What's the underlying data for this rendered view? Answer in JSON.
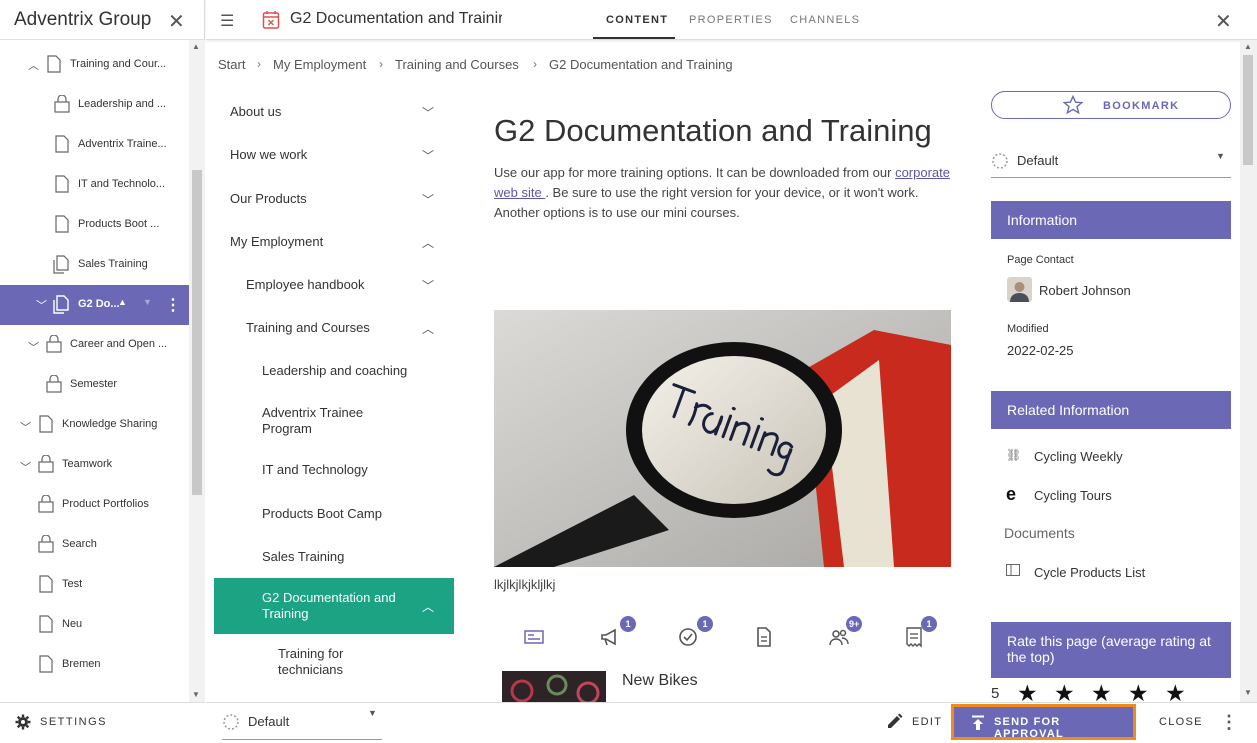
{
  "left_panel": {
    "title": "Adventrix Group",
    "settings_label": "SETTINGS",
    "items": [
      {
        "label": "Training and Cour...",
        "icon": "page-icon",
        "chevron": "up"
      },
      {
        "label": "Leadership and ...",
        "icon": "lock-icon"
      },
      {
        "label": "Adventrix Traine...",
        "icon": "page-icon"
      },
      {
        "label": "IT and Technolo...",
        "icon": "page-icon"
      },
      {
        "label": "Products Boot ...",
        "icon": "page-icon"
      },
      {
        "label": "Sales Training",
        "icon": "copy-page-icon"
      },
      {
        "label": "G2 Do...",
        "icon": "copy-page-icon",
        "selected": true
      },
      {
        "label": "Career and Open ...",
        "icon": "lock-icon",
        "chevron": "down"
      },
      {
        "label": "Semester",
        "icon": "lock-icon"
      },
      {
        "label": "Knowledge Sharing",
        "icon": "page-icon",
        "chevron": "down"
      },
      {
        "label": "Teamwork",
        "icon": "lock-icon",
        "chevron": "down"
      },
      {
        "label": "Product Portfolios",
        "icon": "lock-icon"
      },
      {
        "label": "Search",
        "icon": "lock-icon"
      },
      {
        "label": "Test",
        "icon": "page-icon"
      },
      {
        "label": "Neu",
        "icon": "page-icon"
      },
      {
        "label": "Bremen",
        "icon": "page-icon"
      }
    ]
  },
  "top_bar": {
    "page_title": "G2 Documentation and Trainir",
    "tabs": [
      "CONTENT",
      "PROPERTIES",
      "CHANNELS"
    ],
    "active_tab": "CONTENT"
  },
  "breadcrumb": [
    "Start",
    "My Employment",
    "Training and Courses",
    "G2 Documentation and Training"
  ],
  "side_nav": [
    {
      "label": "About us",
      "chevron": "down"
    },
    {
      "label": "How we work",
      "chevron": "down"
    },
    {
      "label": "Our Products",
      "chevron": "down"
    },
    {
      "label": "My Employment",
      "chevron": "up"
    },
    {
      "label": "Employee handbook",
      "chevron": "down"
    },
    {
      "label": "Training and Courses",
      "chevron": "up"
    },
    {
      "label": "Leadership and coaching"
    },
    {
      "label": "Adventrix Trainee Program"
    },
    {
      "label": "IT and Technology"
    },
    {
      "label": "Products Boot Camp"
    },
    {
      "label": "Sales Training"
    },
    {
      "label": "G2 Documentation and Training",
      "chevron": "up",
      "selected": true
    },
    {
      "label": "Training for technicians"
    }
  ],
  "article": {
    "title": "G2 Documentation and Training",
    "body_before_link": "Use our app for more training options. It can be downloaded from our ",
    "link_text": "corporate web site ",
    "body_after_link": ". Be sure to use the right version for your device, or it won't work. Another options is to use our mini courses.",
    "image_caption": "lkjlkjlkjkljlkj",
    "feed_badges": [
      "1",
      "1",
      "9+",
      "1"
    ],
    "news_item_title": "New Bikes"
  },
  "right_panel": {
    "bookmark_label": "BOOKMARK",
    "language_select": "Default",
    "information_heading": "Information",
    "page_contact_label": "Page Contact",
    "page_contact_name": "Robert Johnson",
    "modified_label": "Modified",
    "modified_value": "2022-02-25",
    "related_heading": "Related Information",
    "related_links": [
      "Cycling Weekly",
      "Cycling Tours"
    ],
    "documents_label": "Documents",
    "documents": [
      "Cycle Products List"
    ],
    "rating_heading": "Rate this page (average rating at the top)",
    "rating_value": "5",
    "rating_stars": 5
  },
  "bottom_bar": {
    "language_select": "Default",
    "edit_label": "EDIT",
    "send_label": "SEND FOR APPROVAL",
    "close_label": "CLOSE"
  },
  "colors": {
    "accent": "#6b69b6",
    "nav_selected": "#1ba384",
    "highlight_border": "#f08a1e"
  }
}
